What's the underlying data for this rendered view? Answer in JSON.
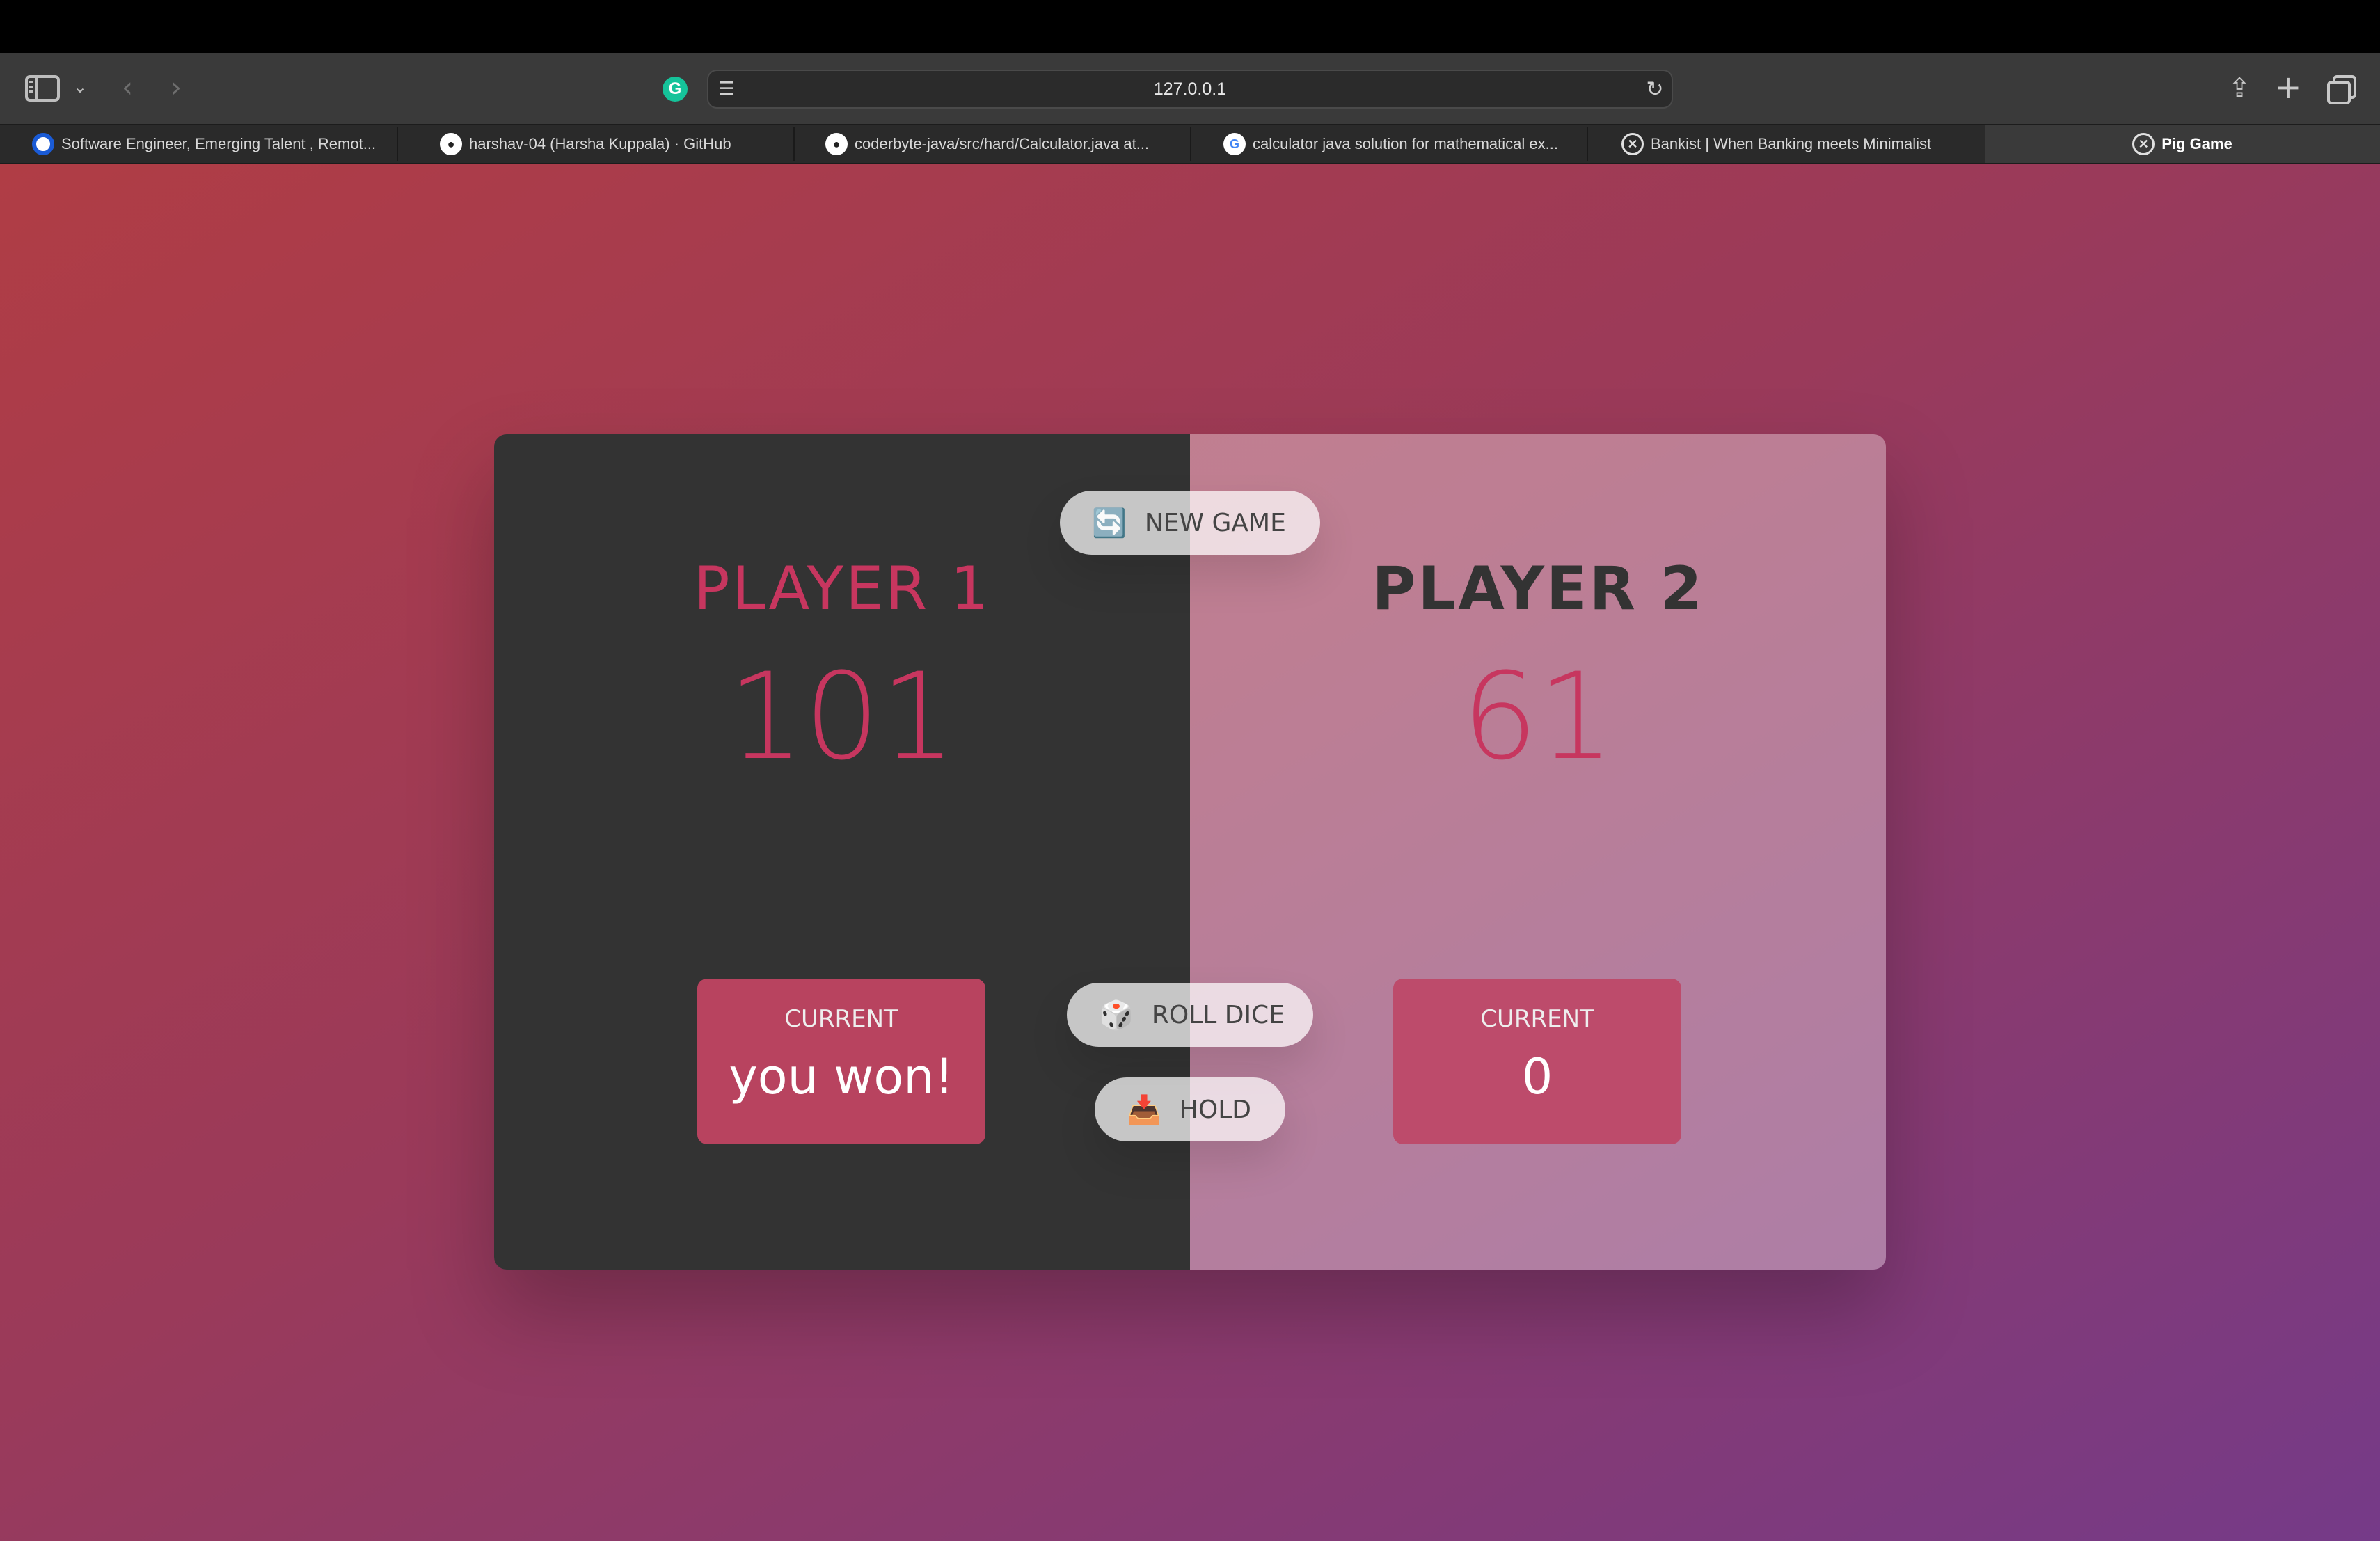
{
  "browser": {
    "url": "127.0.0.1",
    "tabs": [
      {
        "label": "Software Engineer, Emerging Talent , Remot...",
        "icon": "blue-circle-icon"
      },
      {
        "label": "harshav-04 (Harsha Kuppala) · GitHub",
        "icon": "github-icon"
      },
      {
        "label": "coderbyte-java/src/hard/Calculator.java at...",
        "icon": "github-icon"
      },
      {
        "label": "calculator java solution for mathematical ex...",
        "icon": "google-icon"
      },
      {
        "label": "Bankist | When Banking meets Minimalist",
        "icon": "bankist-icon"
      },
      {
        "label": "Pig Game",
        "icon": "bankist-icon",
        "active": true
      }
    ]
  },
  "game": {
    "new_game": "NEW GAME",
    "roll_dice": "ROLL DICE",
    "hold": "HOLD",
    "players": [
      {
        "name": "PLAYER 1",
        "score": "101",
        "current_label": "CURRENT",
        "current": "you won!"
      },
      {
        "name": "PLAYER 2",
        "score": "61",
        "current_label": "CURRENT",
        "current": "0"
      }
    ]
  },
  "colors": {
    "accent": "#c7365f",
    "winner_bg": "#333333",
    "gradient_start": "#b03d45",
    "gradient_end": "#753a88"
  }
}
